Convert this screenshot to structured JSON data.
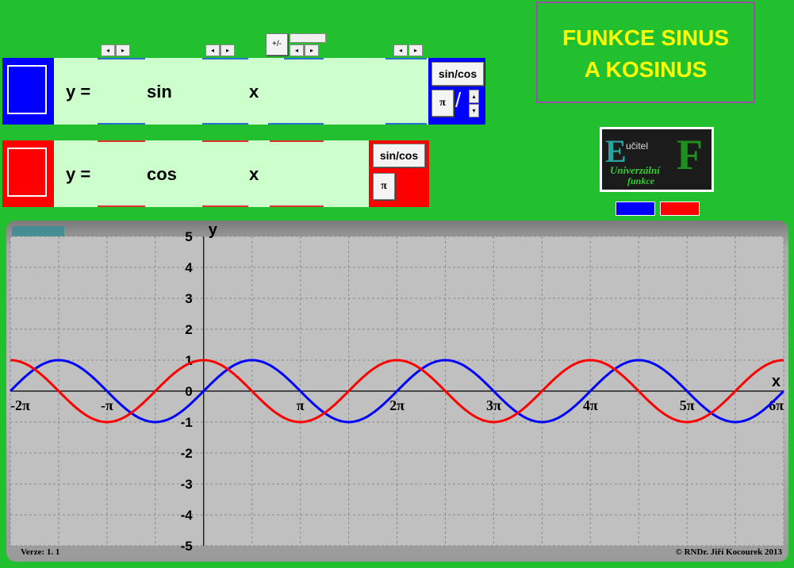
{
  "title": {
    "line1": "FUNKCE SINUS",
    "line2": "A KOSINUS"
  },
  "spinner_glyphs": {
    "left": "◂",
    "right": "▸",
    "up": "▴",
    "down": "▾"
  },
  "plusminus_label": "+/-",
  "rows": [
    {
      "color": "#0000ff",
      "y_label": "y =",
      "func": "sin",
      "var": "x",
      "toggle_label": "sin/cos",
      "pi_label": "π",
      "slash": "/"
    },
    {
      "color": "#ff0000",
      "y_label": "y =",
      "func": "cos",
      "var": "x",
      "toggle_label": "sin/cos",
      "pi_label": "π"
    }
  ],
  "logo": {
    "text1": "E",
    "text2": "učitel",
    "text3": "Univerzální",
    "text4": "funkce",
    "text5": "F"
  },
  "legend_colors": [
    "#0000ff",
    "#ff0000"
  ],
  "graph": {
    "footer_left_label": "Verze:",
    "footer_left_value": "1. 1",
    "footer_right": "© RNDr. Jiří Kocourek 2013"
  },
  "chart_data": {
    "type": "line",
    "xlabel": "x",
    "ylabel": "y",
    "xlim_pi": [
      -2,
      6
    ],
    "ylim": [
      -5,
      5
    ],
    "x_ticks": [
      "-2π",
      "-π",
      "π",
      "2π",
      "3π",
      "4π",
      "5π",
      "6π"
    ],
    "y_ticks": [
      "5",
      "4",
      "3",
      "2",
      "1",
      "0",
      "-1",
      "-2",
      "-3",
      "-4",
      "-5"
    ],
    "grid": true,
    "series": [
      {
        "function": "sin",
        "color": "#0000ff"
      },
      {
        "function": "cos",
        "color": "#ff0000"
      }
    ]
  }
}
